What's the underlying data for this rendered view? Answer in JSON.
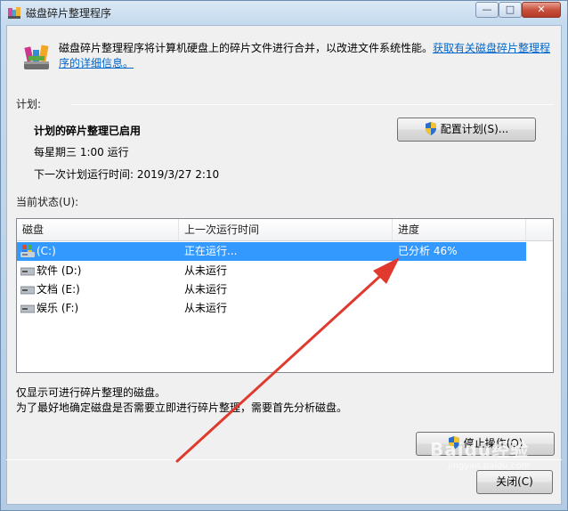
{
  "window": {
    "title": "磁盘碎片整理程序",
    "controls": {
      "minimize": "—",
      "maximize": "□",
      "close": "✕"
    }
  },
  "intro": {
    "text": "磁盘碎片整理程序将计算机硬盘上的碎片文件进行合并，以改进文件系统性能。",
    "link": "获取有关磁盘碎片整理程序的详细信息。"
  },
  "schedule": {
    "section_label": "计划:",
    "status": "计划的碎片整理已启用",
    "frequency": "每星期三  1:00 运行",
    "next_run": "下一次计划运行时间: 2019/3/27 2:10",
    "configure_button": "配置计划(S)..."
  },
  "current_status": {
    "section_label": "当前状态(U):",
    "columns": [
      "磁盘",
      "上一次运行时间",
      "进度"
    ],
    "rows": [
      {
        "disk": "(C:)",
        "last_run": "正在运行...",
        "progress": "已分析 46%",
        "selected": true,
        "icon": "system-drive-icon"
      },
      {
        "disk": "软件 (D:)",
        "last_run": "从未运行",
        "progress": "",
        "selected": false,
        "icon": "hard-drive-icon"
      },
      {
        "disk": "文档 (E:)",
        "last_run": "从未运行",
        "progress": "",
        "selected": false,
        "icon": "hard-drive-icon"
      },
      {
        "disk": "娱乐 (F:)",
        "last_run": "从未运行",
        "progress": "",
        "selected": false,
        "icon": "hard-drive-icon"
      }
    ]
  },
  "notes": {
    "line1": "仅显示可进行碎片整理的磁盘。",
    "line2": "为了最好地确定磁盘是否需要立即进行碎片整理，需要首先分析磁盘。"
  },
  "buttons": {
    "stop": "停止操作(O)",
    "close": "关闭(C)"
  },
  "watermark": {
    "brand": "Baidu经验",
    "url": "jingyan.baidu.com"
  },
  "colors": {
    "selection": "#3399ff",
    "link": "#0066cc",
    "annotation_arrow": "#e03a2f"
  }
}
